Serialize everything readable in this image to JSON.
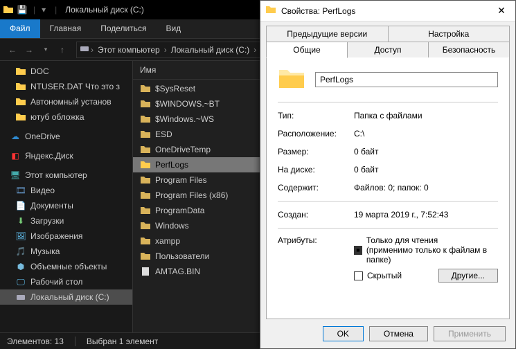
{
  "titlebar": {
    "title": "Локальный диск (C:)"
  },
  "ribbon": {
    "file": "Файл",
    "home": "Главная",
    "share": "Поделиться",
    "view": "Вид"
  },
  "breadcrumb": {
    "pc": "Этот компьютер",
    "disk": "Локальный диск (C:)"
  },
  "column_header": "Имя",
  "sidebar": {
    "quick": [
      {
        "label": "DOC"
      },
      {
        "label": "NTUSER.DAT Что это з"
      },
      {
        "label": "Автономный установ"
      },
      {
        "label": "ютуб обложка"
      }
    ],
    "onedrive": "OneDrive",
    "yandex": "Яндекс.Диск",
    "pc": "Этот компьютер",
    "pc_items": [
      {
        "label": "Видео"
      },
      {
        "label": "Документы"
      },
      {
        "label": "Загрузки"
      },
      {
        "label": "Изображения"
      },
      {
        "label": "Музыка"
      },
      {
        "label": "Объемные объекты"
      },
      {
        "label": "Рабочий стол"
      },
      {
        "label": "Локальный диск (C:)"
      }
    ]
  },
  "files": [
    {
      "label": "$SysReset",
      "type": "folder"
    },
    {
      "label": "$WINDOWS.~BT",
      "type": "folder"
    },
    {
      "label": "$Windows.~WS",
      "type": "folder"
    },
    {
      "label": "ESD",
      "type": "folder"
    },
    {
      "label": "OneDriveTemp",
      "type": "folder"
    },
    {
      "label": "PerfLogs",
      "type": "folder",
      "selected": true
    },
    {
      "label": "Program Files",
      "type": "folder"
    },
    {
      "label": "Program Files (x86)",
      "type": "folder"
    },
    {
      "label": "ProgramData",
      "type": "folder"
    },
    {
      "label": "Windows",
      "type": "folder"
    },
    {
      "label": "xampp",
      "type": "folder"
    },
    {
      "label": "Пользователи",
      "type": "folder"
    },
    {
      "label": "AMTAG.BIN",
      "type": "file"
    }
  ],
  "status": {
    "count": "Элементов: 13",
    "selected": "Выбран 1 элемент"
  },
  "dialog": {
    "title": "Свойства: PerfLogs",
    "tabs": {
      "prev": "Предыдущие версии",
      "settings": "Настройка",
      "general": "Общие",
      "access": "Доступ",
      "security": "Безопасность"
    },
    "name": "PerfLogs",
    "rows": {
      "type_l": "Тип:",
      "type_v": "Папка с файлами",
      "loc_l": "Расположение:",
      "loc_v": "C:\\",
      "size_l": "Размер:",
      "size_v": "0 байт",
      "disk_l": "На диске:",
      "disk_v": "0 байт",
      "cont_l": "Содержит:",
      "cont_v": "Файлов: 0; папок: 0",
      "created_l": "Создан:",
      "created_v": "19 марта 2019 г., 7:52:43",
      "attr_l": "Атрибуты:",
      "readonly": "Только для чтения",
      "readonly_note": "(применимо только к файлам в папке)",
      "hidden": "Скрытый",
      "other": "Другие..."
    },
    "buttons": {
      "ok": "OK",
      "cancel": "Отмена",
      "apply": "Применить"
    }
  }
}
